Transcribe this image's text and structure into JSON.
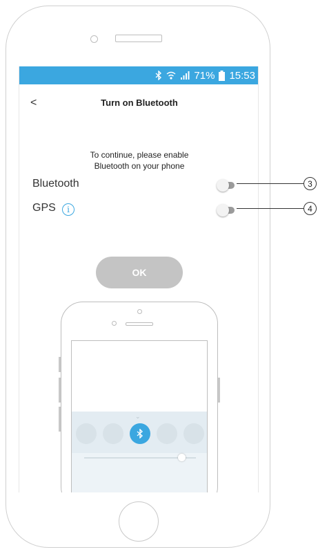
{
  "status_bar": {
    "battery_percent": "71%",
    "time": "15:53",
    "icons": [
      "bluetooth-icon",
      "wifi-icon",
      "signal-icon",
      "battery-icon"
    ],
    "color": "#3ba7e0"
  },
  "header": {
    "back_glyph": "<",
    "title": "Turn on Bluetooth"
  },
  "instructions": {
    "line1": "To continue, please enable",
    "line2": "Bluetooth on your phone"
  },
  "settings": [
    {
      "label": "Bluetooth",
      "enabled": false,
      "callout": "3"
    },
    {
      "label": "GPS",
      "enabled": false,
      "callout": "4",
      "info_icon": "i"
    }
  ],
  "ok_button": {
    "label": "OK"
  },
  "illustration": {
    "bluetooth_glyph": "✱",
    "chevron": "⌄"
  },
  "colors": {
    "accent": "#3ba7e0",
    "button_disabled": "#c4c4c4"
  }
}
